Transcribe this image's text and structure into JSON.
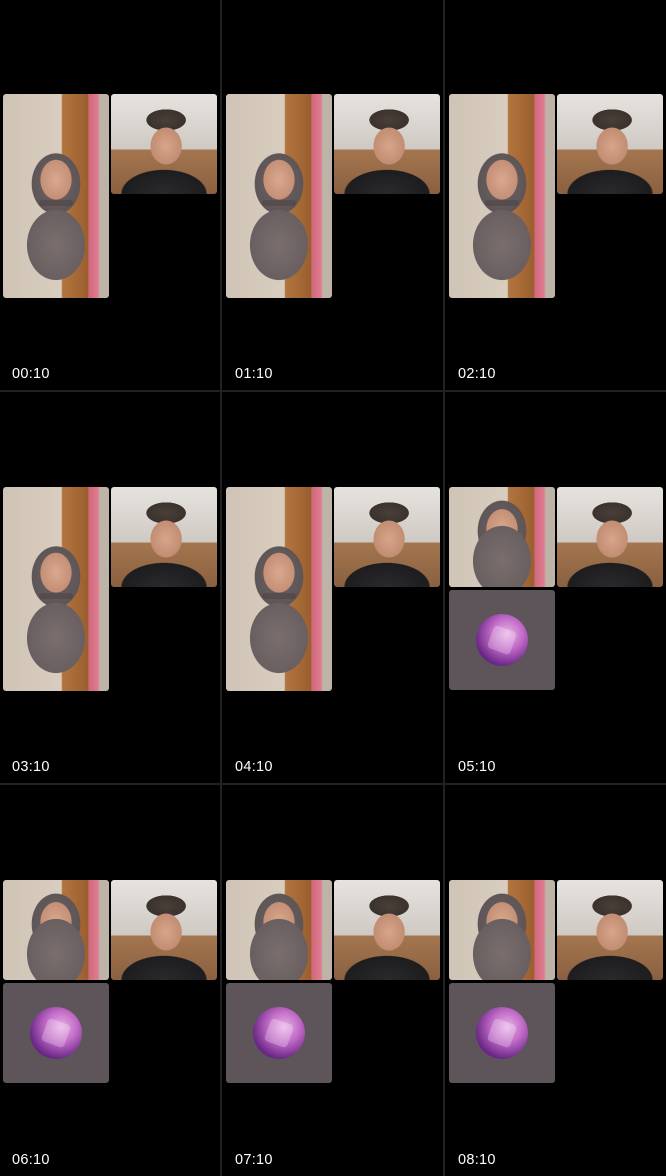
{
  "frames": [
    {
      "timestamp": "00:10",
      "tiles": [
        "participant-a-video",
        "participant-b-video"
      ]
    },
    {
      "timestamp": "01:10",
      "tiles": [
        "participant-a-video",
        "participant-b-video"
      ]
    },
    {
      "timestamp": "02:10",
      "tiles": [
        "participant-a-video",
        "participant-b-video"
      ]
    },
    {
      "timestamp": "03:10",
      "tiles": [
        "participant-a-video",
        "participant-b-video"
      ]
    },
    {
      "timestamp": "04:10",
      "tiles": [
        "participant-a-video",
        "participant-b-video"
      ]
    },
    {
      "timestamp": "05:10",
      "tiles": [
        "participant-a-video",
        "participant-b-video",
        "participant-c-avatar"
      ]
    },
    {
      "timestamp": "06:10",
      "tiles": [
        "participant-a-video",
        "participant-b-video",
        "participant-c-avatar"
      ]
    },
    {
      "timestamp": "07:10",
      "tiles": [
        "participant-a-video",
        "participant-b-video",
        "participant-c-avatar"
      ]
    },
    {
      "timestamp": "08:10",
      "tiles": [
        "participant-a-video",
        "participant-b-video",
        "participant-c-avatar"
      ]
    }
  ],
  "colors": {
    "background": "#000000",
    "divider": "#222222",
    "timestamp_text": "#ffffff",
    "avatar_tile": "#5d5559"
  }
}
